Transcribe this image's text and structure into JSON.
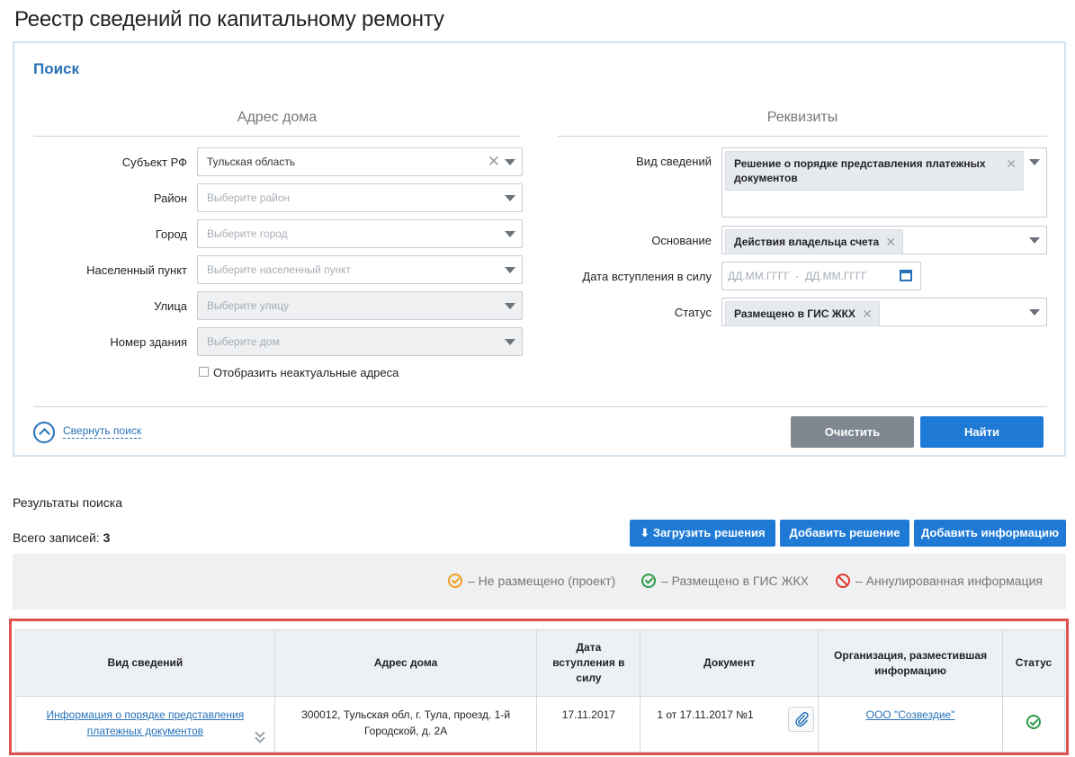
{
  "page_title": "Реестр сведений по капитальному ремонту",
  "search": {
    "title": "Поиск",
    "address_col_title": "Адрес дома",
    "requisites_col_title": "Реквизиты",
    "subject": {
      "label": "Субъект РФ",
      "value": "Тульская область"
    },
    "district": {
      "label": "Район",
      "placeholder": "Выберите район"
    },
    "city": {
      "label": "Город",
      "placeholder": "Выберите город"
    },
    "locality": {
      "label": "Населенный пункт",
      "placeholder": "Выберите населенный пункт"
    },
    "street": {
      "label": "Улица",
      "placeholder": "Выберите улицу"
    },
    "building": {
      "label": "Номер здания",
      "placeholder": "Выберите дом"
    },
    "show_inactive_label": "Отобразить неактуальные адреса",
    "info_type": {
      "label": "Вид сведений",
      "tag": "Решение о порядке представления платежных документов"
    },
    "basis": {
      "label": "Основание",
      "tag": "Действия владельца счета"
    },
    "effective_date": {
      "label": "Дата вступления в силу",
      "from_placeholder": "ДД.ММ.ГГГГ",
      "separator": "-",
      "to_placeholder": "ДД.ММ.ГГГГ"
    },
    "status": {
      "label": "Статус",
      "tag": "Размещено в ГИС ЖКХ"
    },
    "collapse_label": "Свернуть поиск",
    "clear_label": "Очистить",
    "find_label": "Найти"
  },
  "results": {
    "label": "Результаты поиска",
    "total_label": "Всего записей:",
    "total_count": "3",
    "upload_label": "Загрузить решения",
    "add_decision_label": "Добавить решение",
    "add_info_label": "Добавить информацию",
    "legend": [
      {
        "text": "–  Не размещено (проект)",
        "color": "#f0a01e"
      },
      {
        "text": "–  Размещено в ГИС ЖКХ",
        "color": "#2e9b48"
      },
      {
        "text": "–  Аннулированная информация",
        "color": "#e0392f"
      }
    ],
    "columns": {
      "info_type": "Вид сведений",
      "address": "Адрес дома",
      "effective_date": "Дата вступления в силу",
      "document": "Документ",
      "organization": "Организация, разместившая информацию",
      "status": "Статус"
    },
    "rows": [
      {
        "info_type": "Информация о порядке представления платежных документов",
        "address": "300012, Тульская обл, г. Тула, проезд. 1-й Городской, д. 2А",
        "effective_date": "17.11.2017",
        "document": "1 от 17.11.2017 №1",
        "organization": "ООО \"Созвездие\""
      }
    ]
  },
  "colors": {
    "accent": "#2771b8",
    "button_blue": "#1e7ad5",
    "button_grey": "#7f8790",
    "highlight_border": "#e0524e"
  }
}
